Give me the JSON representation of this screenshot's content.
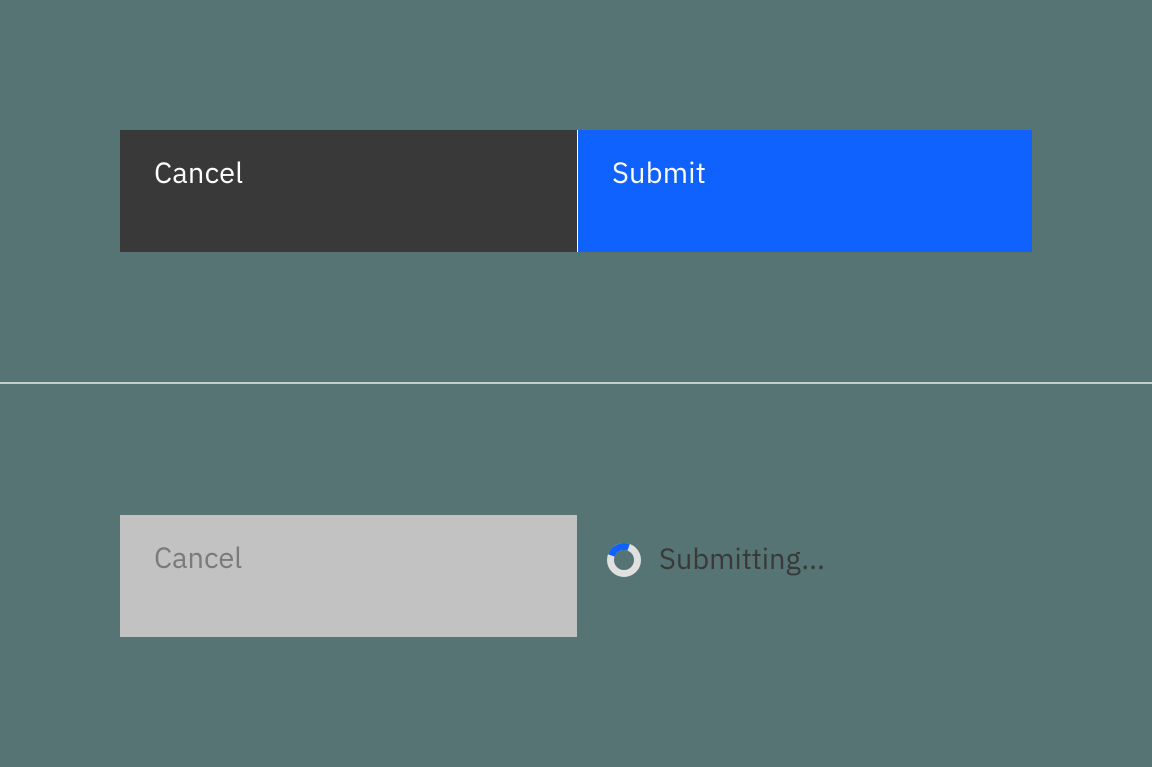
{
  "buttons": {
    "cancel": "Cancel",
    "submit": "Submit",
    "cancel_disabled": "Cancel",
    "submitting": "Submitting..."
  },
  "colors": {
    "background": "#567474",
    "secondary_bg": "#393939",
    "primary_bg": "#0f62fe",
    "disabled_bg": "#c2c2c2",
    "disabled_text": "#7a7a7a",
    "spinner_track": "#e0e0e0",
    "spinner_arc": "#0f62fe"
  },
  "icons": {
    "spinner": "loading-spinner-icon"
  }
}
